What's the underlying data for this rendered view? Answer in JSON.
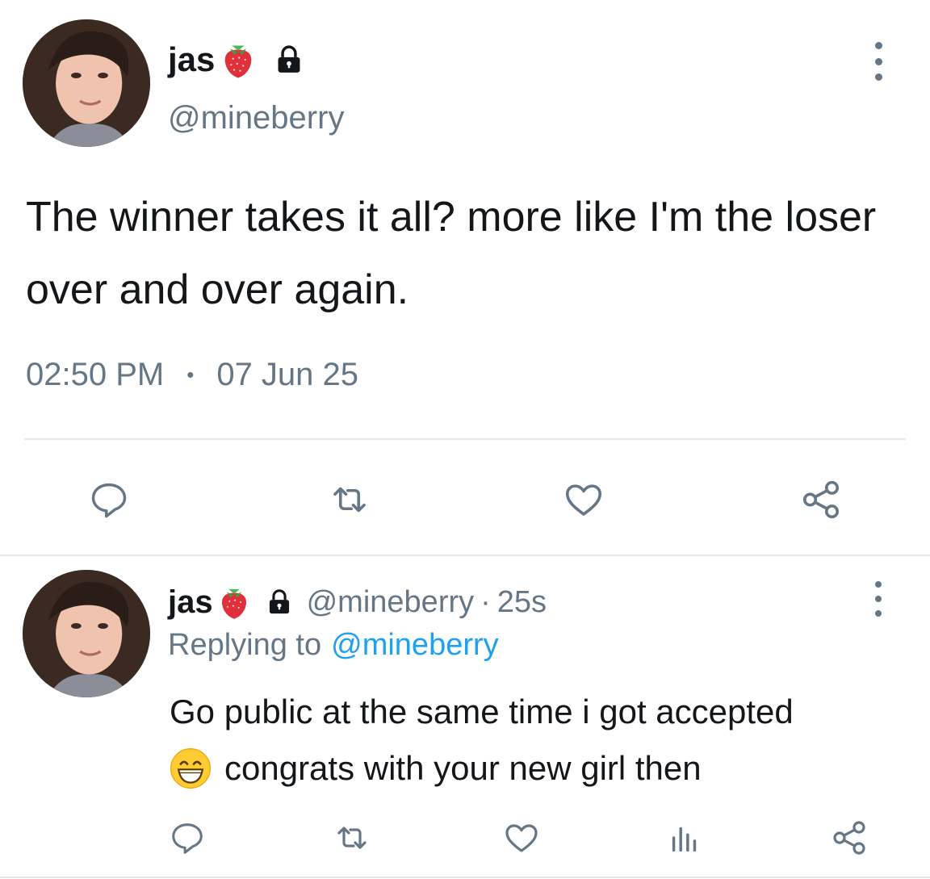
{
  "main_tweet": {
    "display_name": "jas",
    "handle": "@mineberry",
    "text": "The winner takes it all? more like I'm the loser over and over again.",
    "time": "02:50 PM",
    "separator": "•",
    "date": "07 Jun 25",
    "name_emoji": "strawberry-icon",
    "protected": true
  },
  "reply_tweet": {
    "display_name": "jas",
    "handle": "@mineberry",
    "dot": "·",
    "age": "25s",
    "replying_prefix": "Replying to",
    "replying_handle": "@mineberry",
    "text_line1": "Go public at the same time i got accepted",
    "text_line2": "congrats with your new girl then",
    "emoji": "grinning-face-icon",
    "protected": true
  },
  "colors": {
    "text": "#14171a",
    "muted": "#657786",
    "link": "#1da1f2",
    "divider": "#e1e8ed",
    "icon": "#657786"
  }
}
